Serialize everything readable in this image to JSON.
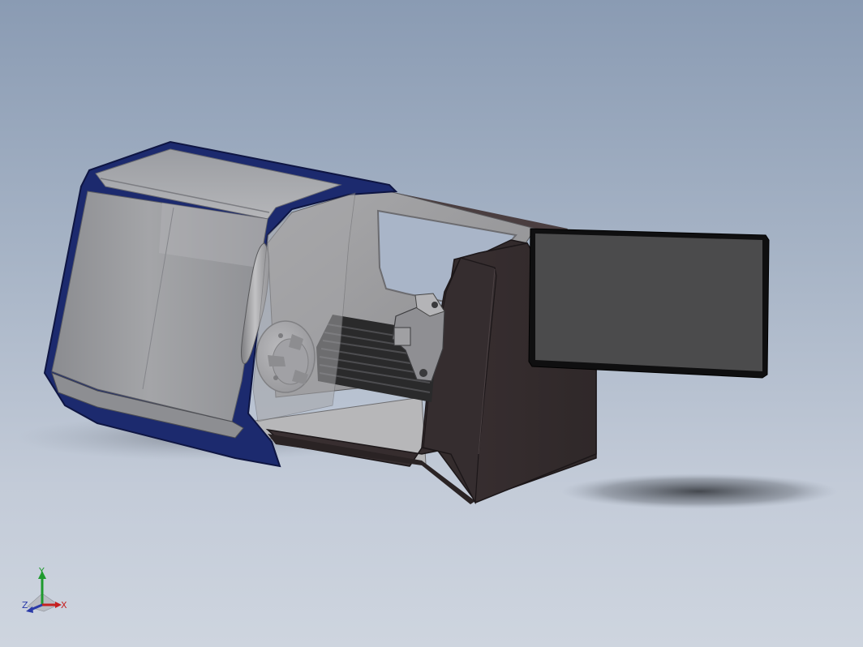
{
  "viewport": {
    "background_top": "#8a9bb3",
    "background_bottom": "#ced5df"
  },
  "model": {
    "name": "cnc-lathe-assembly",
    "colors": {
      "blue_trim": "#1c2a6e",
      "door_gray": "#9a9a9d",
      "body_brown": "#3c3234",
      "screen": "#4a4a4a",
      "bellows": "#2b2b2b",
      "chuck": "#b8b8bc"
    }
  },
  "triad": {
    "x_label": "X",
    "y_label": "Y",
    "z_label": "Z",
    "x_color": "#c62020",
    "y_color": "#1f9a2e",
    "z_color": "#2a3aa8"
  }
}
